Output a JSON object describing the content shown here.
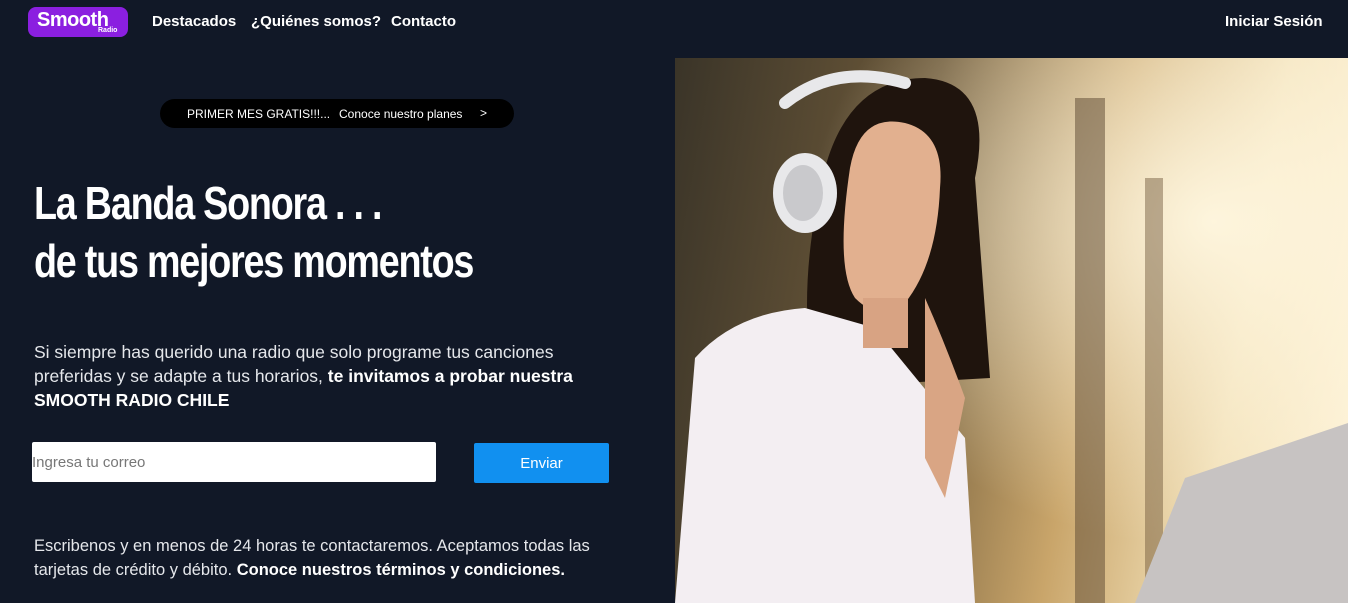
{
  "nav": {
    "logo_main": "Smooth",
    "logo_sub": "Radio",
    "links": [
      "Destacados",
      "¿Quiénes somos?",
      "Contacto"
    ],
    "login": "Iniciar Sesión"
  },
  "promo": {
    "free": "PRIMER MES GRATIS!!!...",
    "plans": "Conoce nuestro planes",
    "chevron": ">"
  },
  "headline": {
    "line1": "La Banda Sonora . . .",
    "line2": "de tus mejores momentos"
  },
  "intro": {
    "normal": "Si siempre has querido una radio que solo programe tus canciones preferidas y se adapte a tus horarios,",
    "bold": "te invitamos a probar nuestra SMOOTH RADIO CHILE"
  },
  "form": {
    "email_placeholder": "Ingresa tu correo",
    "email_value": "",
    "submit_label": "Enviar"
  },
  "footer": {
    "normal": "Escribenos y en menos de 24 horas te contactaremos. Aceptamos todas las tarjetas de crédito y débito.",
    "link": "Conoce nuestros términos y condiciones."
  },
  "colors": {
    "background": "#111827",
    "brand": "#8b1fe0",
    "button": "#1190f0"
  }
}
